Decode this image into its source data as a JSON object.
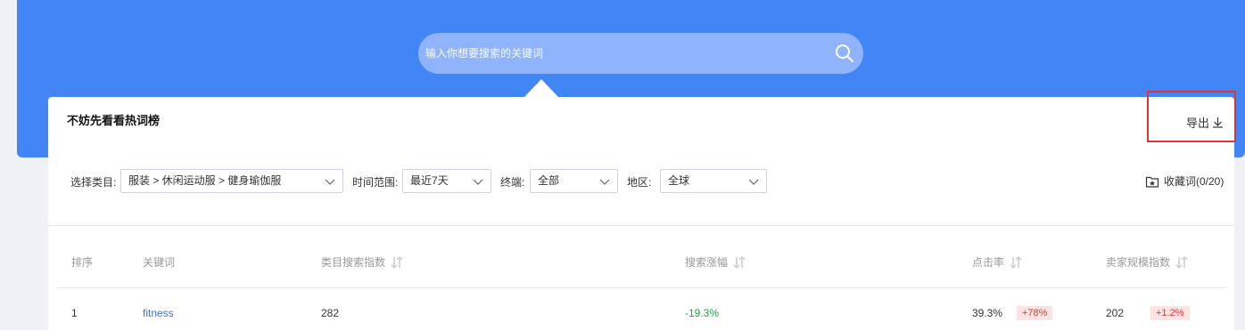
{
  "search": {
    "placeholder": "输入你想要搜索的关键词"
  },
  "hot": {
    "title": "不妨先看看热词榜"
  },
  "export": {
    "label": "导出"
  },
  "filters": {
    "category_label": "选择类目:",
    "category_value": "服装 > 休闲运动服 > 健身瑜伽服",
    "time_label": "时间范围:",
    "time_value": "最近7天",
    "device_label": "终端:",
    "device_value": "全部",
    "region_label": "地区:",
    "region_value": "全球"
  },
  "collect": {
    "label": "收藏词(0/20)"
  },
  "table": {
    "headers": {
      "rank": "排序",
      "keyword": "关键词",
      "category_index": "类目搜索指数",
      "growth": "搜索涨幅",
      "ctr": "点击率",
      "seller_index": "卖家规模指数"
    },
    "rows": [
      {
        "rank": "1",
        "keyword": "fitness",
        "category_index": "282",
        "growth": "-19.3%",
        "ctr": "39.3%",
        "ctr_change": "+78%",
        "seller_index": "202",
        "seller_change": "+1.2%"
      }
    ]
  },
  "colors": {
    "hero": "#4285f4",
    "highlight": "#e5332f",
    "link": "#3c73d6",
    "negative_growth": "#26a046"
  }
}
